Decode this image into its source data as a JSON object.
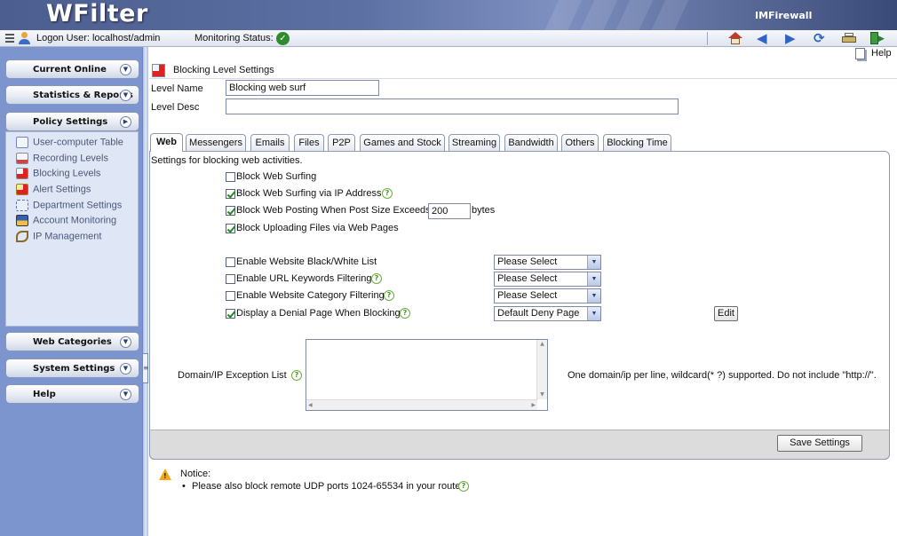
{
  "app": {
    "title": "WFilter",
    "brand": "IMFirewall"
  },
  "statusbar": {
    "logon_label": "Logon User: localhost/admin",
    "monitoring_label": "Monitoring Status:"
  },
  "toolbar": {
    "help_label": "Help"
  },
  "sidebar": {
    "current_online": "Current Online",
    "statistics": "Statistics & Reports",
    "policy": "Policy Settings",
    "policy_items": [
      "User-computer Table",
      "Recording Levels",
      "Blocking Levels",
      "Alert Settings",
      "Department Settings",
      "Account Monitoring",
      "IP Management"
    ],
    "web_categories": "Web Categories",
    "system_settings": "System Settings",
    "help": "Help"
  },
  "page": {
    "title": "Blocking Level Settings",
    "level_name_label": "Level Name",
    "level_name_value": "Blocking web surf",
    "level_desc_label": "Level Desc",
    "level_desc_value": ""
  },
  "tabs": [
    "Web",
    "Messengers",
    "Emails",
    "Files",
    "P2P",
    "Games and Stock",
    "Streaming",
    "Bandwidth",
    "Others",
    "Blocking Time"
  ],
  "web": {
    "intro": "Settings for blocking web activities.",
    "options": [
      {
        "label": "Block Web Surfing",
        "checked": false
      },
      {
        "label": "Block Web Surfing via IP Address",
        "checked": true
      },
      {
        "label": "Block Web Posting When Post Size Exceeds",
        "checked": true
      },
      {
        "label": "Block Uploading Files via Web Pages",
        "checked": true
      }
    ],
    "post_size_value": "200",
    "post_size_unit": "bytes",
    "filters": [
      {
        "label": "Enable Website Black/White List",
        "checked": false,
        "select": "Please Select"
      },
      {
        "label": "Enable URL Keywords Filtering",
        "checked": false,
        "select": "Please Select"
      },
      {
        "label": "Enable Website Category Filtering",
        "checked": false,
        "select": "Please Select"
      },
      {
        "label": "Display a Denial Page When Blocking",
        "checked": true,
        "select": "Default Deny Page"
      }
    ],
    "edit_button": "Edit",
    "exception_label": "Domain/IP Exception List",
    "exception_hint": "One domain/ip per line, wildcard(* ?) supported. Do not include \"http://\".",
    "save_button": "Save Settings"
  },
  "notice": {
    "title": "Notice:",
    "items": [
      "Please also block remote UDP ports 1024-65534 in your router."
    ]
  }
}
